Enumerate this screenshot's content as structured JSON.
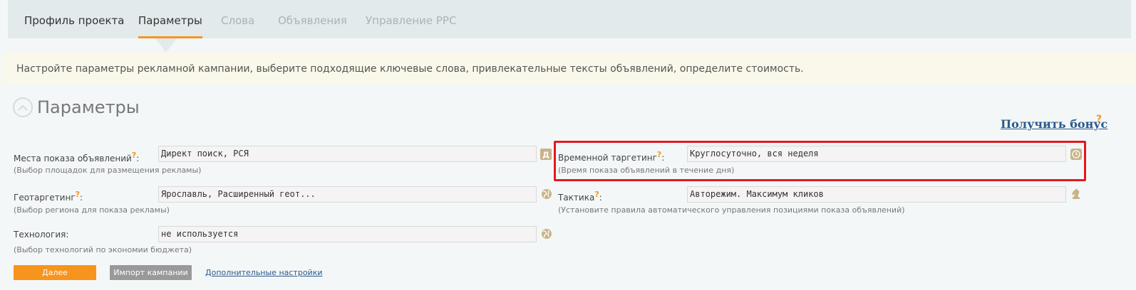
{
  "tabs": [
    {
      "label": "Профиль проекта",
      "state": "normal"
    },
    {
      "label": "Параметры",
      "state": "active"
    },
    {
      "label": "Слова",
      "state": "disabled"
    },
    {
      "label": "Объявления",
      "state": "disabled"
    },
    {
      "label": "Управление PPC",
      "state": "disabled"
    }
  ],
  "notice": "Настройте параметры рекламной кампании, выберите подходящие ключевые слова, привлекательные тексты объявлений, определите стоимость.",
  "section": {
    "title": "Параметры"
  },
  "bonus": {
    "label": "Получить бонус",
    "help": "?"
  },
  "fields": {
    "ad_places": {
      "label": "Места показа объявлений",
      "help": "?",
      "colon": ":",
      "hint": "(Выбор площадок для размещения рекламы)",
      "value": "Директ поиск, РСЯ",
      "icon": "direct-icon"
    },
    "geo": {
      "label": "Геотаргетинг",
      "help": "?",
      "colon": ":",
      "hint": "(Выбор региона для показа рекламы)",
      "value": "Ярославль, Расширенный геот...",
      "icon": "globe-icon"
    },
    "technology": {
      "label": "Технология:",
      "hint": "(Выбор технологий по экономии бюджета)",
      "value": "не используется",
      "icon": "globe-icon"
    },
    "time_targeting": {
      "label": "Временной таргетинг",
      "help": "?",
      "colon": ":",
      "hint": "(Время показа объявлений в течение дня)",
      "value": "Круглосуточно, вся неделя",
      "icon": "clock-icon"
    },
    "tactics": {
      "label": "Тактика",
      "help": "?",
      "colon": ":",
      "hint": "(Установите правила автоматического управления позициями показа объявлений)",
      "value": "Авторежим. Максимум кликов",
      "icon": "chess-knight-icon"
    }
  },
  "buttons": {
    "next": "Далее",
    "import": "Импорт кампании",
    "more_settings": "Дополнительные настройки"
  },
  "colors": {
    "accent": "#f7941d",
    "link": "#2a5b8c",
    "highlight": "#e3191f",
    "tabs_bg": "#e3eaec",
    "notice_bg": "#f9f8ea"
  }
}
